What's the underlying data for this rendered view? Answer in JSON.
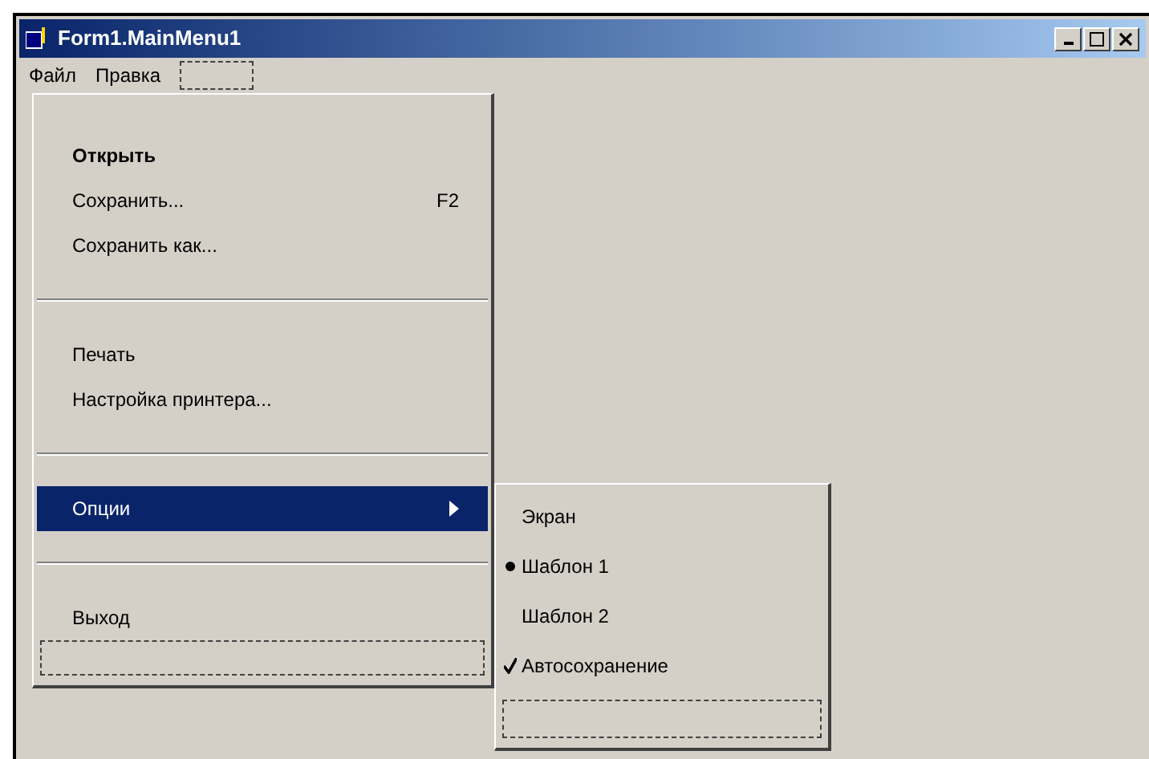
{
  "window": {
    "title": "Form1.MainMenu1"
  },
  "menubar": [
    {
      "kind": "item",
      "label": "Файл"
    },
    {
      "kind": "item",
      "label": "Правка"
    },
    {
      "kind": "placeholder"
    }
  ],
  "menu": [
    {
      "kind": "item",
      "label": "Открыть",
      "bold": true,
      "selected": false
    },
    {
      "kind": "item",
      "label": "Сохранить...",
      "shortcut": "F2",
      "bold": false,
      "selected": false
    },
    {
      "kind": "item",
      "label": "Сохранить как...",
      "bold": false,
      "selected": false
    },
    {
      "kind": "separator"
    },
    {
      "kind": "item",
      "label": "Печать",
      "bold": false,
      "selected": false
    },
    {
      "kind": "item",
      "label": "Настройка принтера...",
      "bold": false,
      "selected": false
    },
    {
      "kind": "separator"
    },
    {
      "kind": "submenu",
      "label": "Опции",
      "bold": false,
      "selected": true
    },
    {
      "kind": "separator"
    },
    {
      "kind": "item",
      "label": "Выход",
      "bold": false,
      "selected": false
    },
    {
      "kind": "placeholder"
    }
  ],
  "submenu": [
    {
      "kind": "plain",
      "label": "Экран"
    },
    {
      "kind": "radio",
      "label": "Шаблон 1",
      "checked": true
    },
    {
      "kind": "plain",
      "label": "Шаблон 2"
    },
    {
      "kind": "check",
      "label": "Автосохранение",
      "checked": true
    },
    {
      "kind": "placeholder"
    }
  ]
}
